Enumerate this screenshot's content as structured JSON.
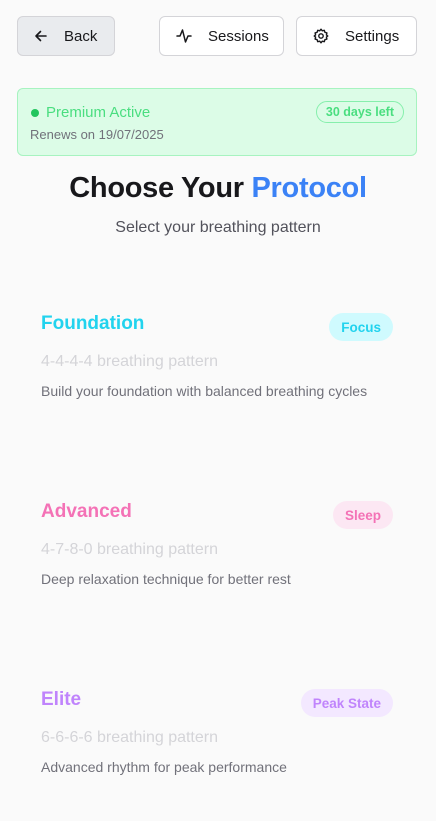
{
  "header": {
    "back_label": "Back",
    "sessions_label": "Sessions",
    "settings_label": "Settings"
  },
  "premium": {
    "status": "Premium Active",
    "renews": "Renews on 19/07/2025",
    "days_left": "30 days left"
  },
  "page": {
    "title_main": "Choose Your ",
    "title_accent": "Protocol",
    "subtitle": "Select your breathing pattern"
  },
  "protocols": [
    {
      "name": "Foundation",
      "badge": "Focus",
      "pattern": "4-4-4-4 breathing pattern",
      "description": "Build your foundation with balanced breathing cycles",
      "color": "#22d3ee",
      "badge_bg": "#cffafe"
    },
    {
      "name": "Advanced",
      "badge": "Sleep",
      "pattern": "4-7-8-0 breathing pattern",
      "description": "Deep relaxation technique for better rest",
      "color": "#f472b6",
      "badge_bg": "#fce7f3"
    },
    {
      "name": "Elite",
      "badge": "Peak State",
      "pattern": "6-6-6-6 breathing pattern",
      "description": "Advanced rhythm for peak performance",
      "color": "#c084fc",
      "badge_bg": "#f3e8ff"
    }
  ]
}
